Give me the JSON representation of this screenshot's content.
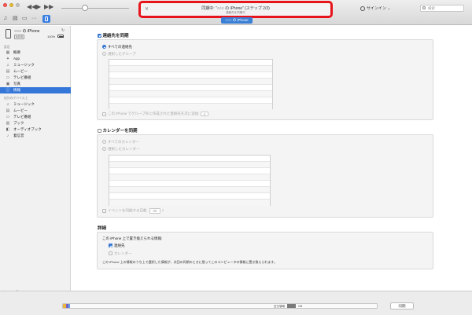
{
  "titlebar": {
    "transport": {
      "prev": "◀◀",
      "play": "▶",
      "next": "▶▶"
    },
    "status": {
      "main": "同期中: “○○○ の iPhone” (ステップ 2/3)",
      "sub": "連絡先を同期中"
    },
    "signin": "サインイン",
    "search_placeholder": "検索",
    "device_tab": "○○○ の iPhone",
    "highlight_color": "#e8141c"
  },
  "sidebar": {
    "device": {
      "name": "○○○ の iPhone",
      "capacity": "64GB",
      "battery": "100%",
      "battery_level": 1.0
    },
    "settings_head": "設定",
    "settings_items": [
      {
        "label": "概要",
        "icon": "summary-icon"
      },
      {
        "label": "App",
        "icon": "app-icon"
      },
      {
        "label": "ミュージック",
        "icon": "music-icon"
      },
      {
        "label": "ムービー",
        "icon": "movie-icon"
      },
      {
        "label": "テレビ番組",
        "icon": "tv-icon"
      },
      {
        "label": "写真",
        "icon": "photo-icon"
      },
      {
        "label": "情報",
        "icon": "info-icon",
        "selected": true
      }
    ],
    "ondevice_head": "自分のデバイス上",
    "ondevice_items": [
      {
        "label": "ミュージック",
        "icon": "music-icon"
      },
      {
        "label": "ムービー",
        "icon": "movie-icon"
      },
      {
        "label": "テレビ番組",
        "icon": "tv-icon"
      },
      {
        "label": "ブック",
        "icon": "book-icon"
      },
      {
        "label": "オーディオブック",
        "icon": "audiobook-icon"
      },
      {
        "label": "着信音",
        "icon": "bell-icon"
      }
    ],
    "footer": {
      "add": "+",
      "gear": "⚙"
    }
  },
  "contacts": {
    "title": "連絡先を同期",
    "all": "すべての連絡先",
    "selected_groups": "選択したグループ",
    "add_to_group": "この iPhone でグループ外に作成された連絡先を次に追加:"
  },
  "calendars": {
    "title": "カレンダーを同期",
    "all": "すべてのカレンダー",
    "selected": "選択したカレンダー",
    "days_label": "イベントを同期する日数",
    "days_value": "30"
  },
  "details": {
    "title": "詳細",
    "replace_label": "この iPhone 上で置き換えられる情報:",
    "contacts": "連絡先",
    "calendars": "カレンダー",
    "note": "この iPhone 上の情報のうち上で選択した情報が、次回の同期のときに限ってこのコンピュータの情報に置き換えられます。"
  },
  "bottombar": {
    "usage_label": "空き領域",
    "usage_free": "GB",
    "sync": "同期"
  }
}
